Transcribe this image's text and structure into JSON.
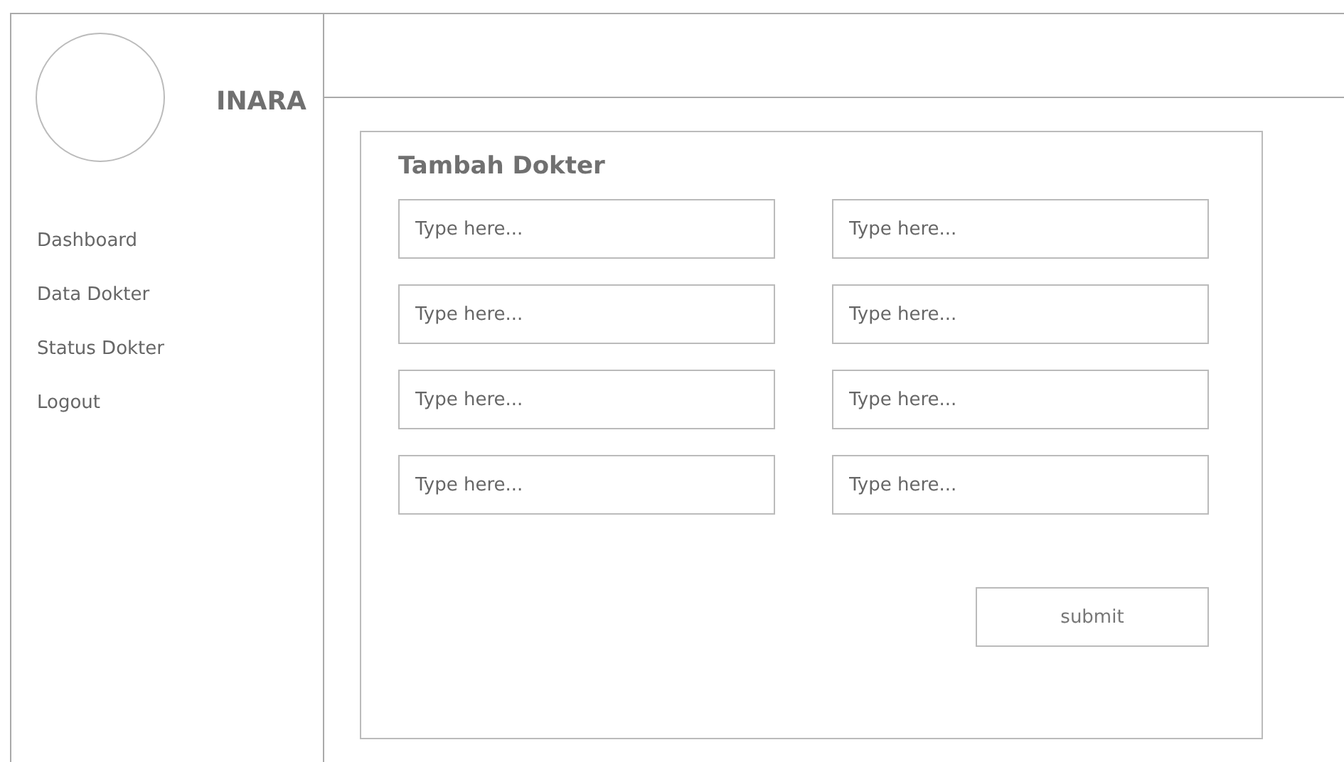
{
  "sidebar": {
    "brand": "INARA",
    "items": [
      {
        "label": "Dashboard"
      },
      {
        "label": "Data Dokter"
      },
      {
        "label": "Status Dokter"
      },
      {
        "label": "Logout"
      }
    ]
  },
  "form": {
    "title": "Tambah Dokter",
    "fields": [
      {
        "placeholder": "Type here..."
      },
      {
        "placeholder": "Type here..."
      },
      {
        "placeholder": "Type here..."
      },
      {
        "placeholder": "Type here..."
      },
      {
        "placeholder": "Type here..."
      },
      {
        "placeholder": "Type here..."
      },
      {
        "placeholder": "Type here..."
      },
      {
        "placeholder": "Type here..."
      }
    ],
    "submit": "submit"
  }
}
